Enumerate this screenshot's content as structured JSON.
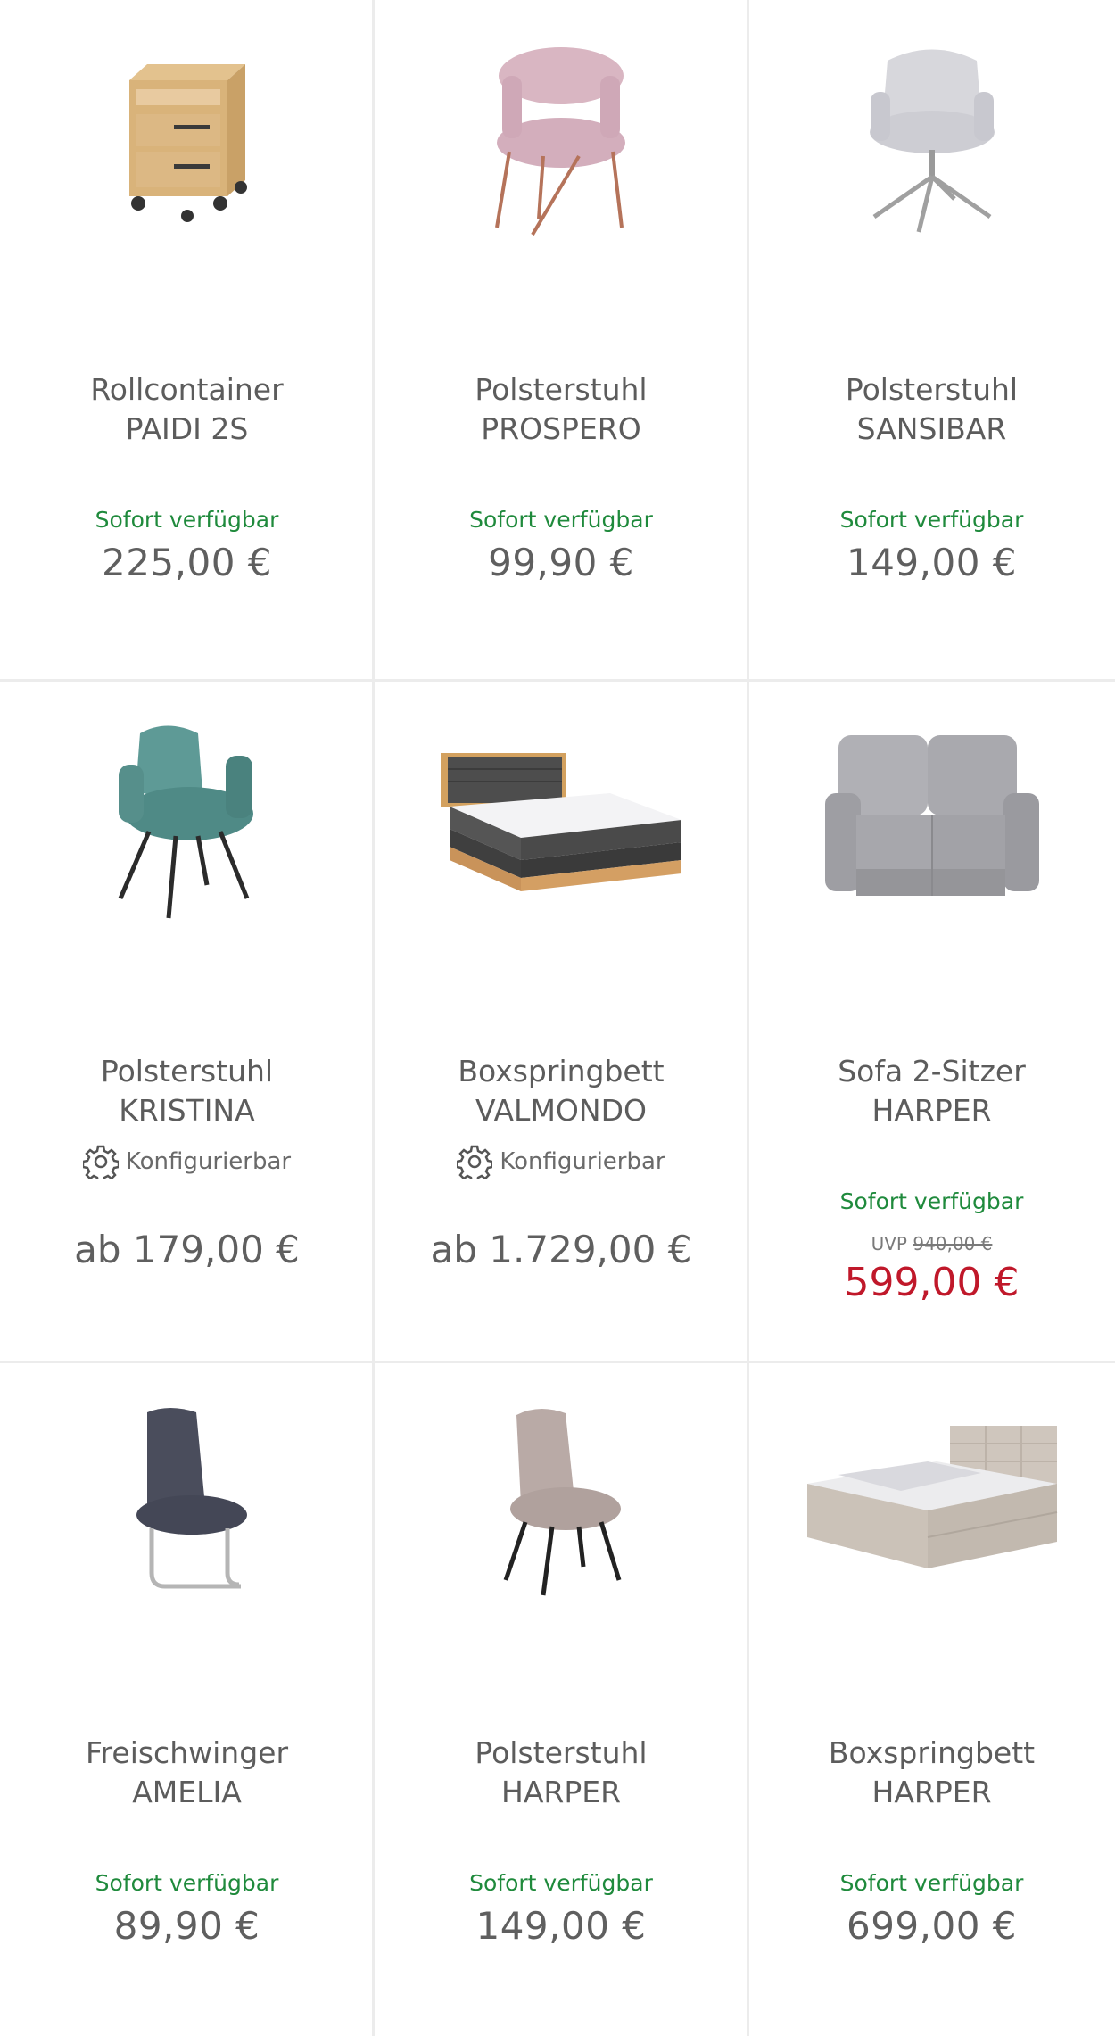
{
  "colors": {
    "availability": "#1f8a3c",
    "sale_price": "#c0182a",
    "text": "#5f5f5f",
    "divider": "#ececec"
  },
  "products": [
    {
      "name_line1": "Rollcontainer",
      "name_line2": "PAIDI 2S",
      "availability": "Sofort verfügbar",
      "price": "225,00 €",
      "image": "rolling-cabinet"
    },
    {
      "name_line1": "Polsterstuhl",
      "name_line2": "PROSPERO",
      "availability": "Sofort verfügbar",
      "price": "99,90 €",
      "image": "pink-chair"
    },
    {
      "name_line1": "Polsterstuhl",
      "name_line2": "SANSIBAR",
      "availability": "Sofort verfügbar",
      "price": "149,00 €",
      "image": "grey-swivel-chair"
    },
    {
      "name_line1": "Polsterstuhl",
      "name_line2": "KRISTINA",
      "config_label": "Konfigurierbar",
      "price": "ab 179,00 €",
      "image": "teal-chair"
    },
    {
      "name_line1": "Boxspringbett",
      "name_line2": "VALMONDO",
      "config_label": "Konfigurierbar",
      "price": "ab 1.729,00 €",
      "image": "boxspring-bed-dark"
    },
    {
      "name_line1": "Sofa 2-Sitzer",
      "name_line2": "HARPER",
      "availability": "Sofort verfügbar",
      "uvp_label": "UVP",
      "uvp_price": "940,00 €",
      "sale_price": "599,00 €",
      "image": "grey-sofa"
    },
    {
      "name_line1": "Freischwinger",
      "name_line2": "AMELIA",
      "availability": "Sofort verfügbar",
      "price": "89,90 €",
      "image": "cantilever-chair"
    },
    {
      "name_line1": "Polsterstuhl",
      "name_line2": "HARPER",
      "availability": "Sofort verfügbar",
      "price": "149,00 €",
      "image": "beige-chair"
    },
    {
      "name_line1": "Boxspringbett",
      "name_line2": "HARPER",
      "availability": "Sofort verfügbar",
      "price": "699,00 €",
      "image": "boxspring-bed-beige"
    }
  ]
}
